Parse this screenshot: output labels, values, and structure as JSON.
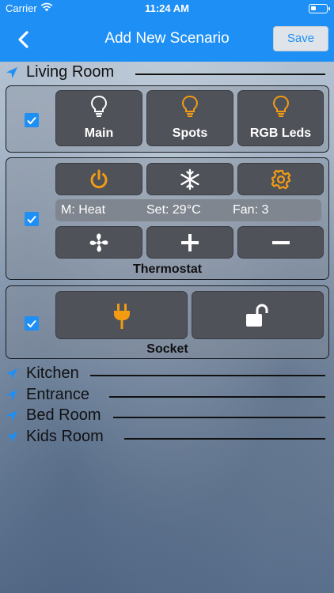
{
  "status_bar": {
    "carrier": "Carrier",
    "time": "11:24 AM"
  },
  "nav": {
    "title": "Add New Scenario",
    "save_label": "Save",
    "back_icon": "chevron-left-icon"
  },
  "rooms": {
    "living_room": "Living Room",
    "kitchen": "Kitchen",
    "entrance": "Entrance",
    "bed_room": "Bed Room",
    "kids_room": "Kids Room"
  },
  "lights": {
    "checked": true,
    "items": [
      {
        "label": "Main",
        "icon": "lightbulb-icon",
        "color": "#ffffff"
      },
      {
        "label": "Spots",
        "icon": "lightbulb-icon",
        "color": "#f39c12"
      },
      {
        "label": "RGB Leds",
        "icon": "lightbulb-icon",
        "color": "#f39c12"
      }
    ]
  },
  "thermostat": {
    "checked": true,
    "title": "Thermostat",
    "mode": "M: Heat",
    "setpoint": "Set: 29°C",
    "fan": "Fan: 3",
    "controls": [
      "power-icon",
      "snowflake-icon",
      "gear-icon",
      "fan-icon",
      "plus-icon",
      "minus-icon"
    ]
  },
  "socket": {
    "checked": true,
    "title": "Socket",
    "controls": [
      "plug-icon",
      "unlock-icon"
    ]
  },
  "colors": {
    "accent": "#1e8ff5",
    "active_orange": "#f39c12",
    "tile_bg": "#50525a"
  }
}
